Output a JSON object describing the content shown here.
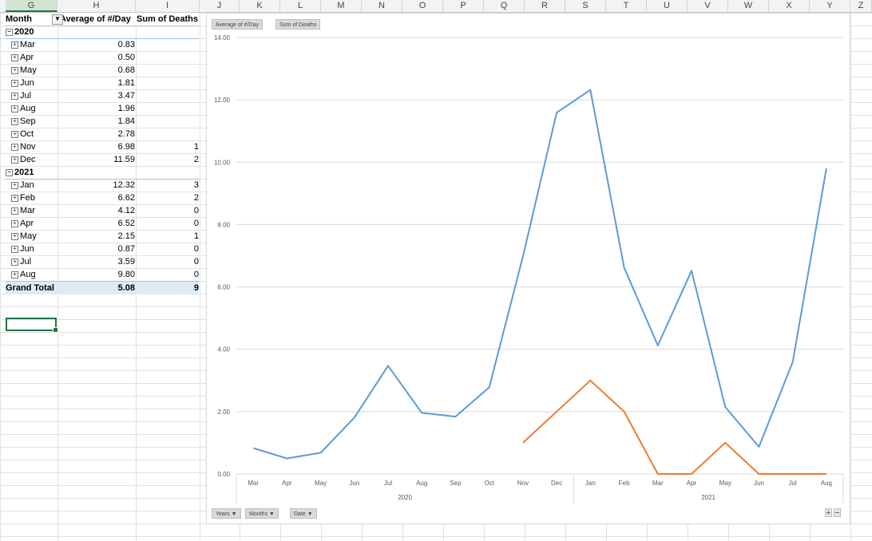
{
  "columns": [
    "G",
    "H",
    "I",
    "J",
    "K",
    "L",
    "M",
    "N",
    "O",
    "P",
    "Q",
    "R",
    "S",
    "T",
    "U",
    "V",
    "W",
    "X",
    "Y",
    "Z"
  ],
  "selected_column": "G",
  "pivot": {
    "headers": [
      "Month",
      "Average of #/Day",
      "Sum of Deaths"
    ],
    "groups": [
      {
        "year": "2020",
        "rows": [
          {
            "month": "Mar",
            "avg": "0.83",
            "deaths": ""
          },
          {
            "month": "Apr",
            "avg": "0.50",
            "deaths": ""
          },
          {
            "month": "May",
            "avg": "0.68",
            "deaths": ""
          },
          {
            "month": "Jun",
            "avg": "1.81",
            "deaths": ""
          },
          {
            "month": "Jul",
            "avg": "3.47",
            "deaths": ""
          },
          {
            "month": "Aug",
            "avg": "1.96",
            "deaths": ""
          },
          {
            "month": "Sep",
            "avg": "1.84",
            "deaths": ""
          },
          {
            "month": "Oct",
            "avg": "2.78",
            "deaths": ""
          },
          {
            "month": "Nov",
            "avg": "6.98",
            "deaths": "1"
          },
          {
            "month": "Dec",
            "avg": "11.59",
            "deaths": "2"
          }
        ]
      },
      {
        "year": "2021",
        "rows": [
          {
            "month": "Jan",
            "avg": "12.32",
            "deaths": "3"
          },
          {
            "month": "Feb",
            "avg": "6.62",
            "deaths": "2"
          },
          {
            "month": "Mar",
            "avg": "4.12",
            "deaths": "0"
          },
          {
            "month": "Apr",
            "avg": "6.52",
            "deaths": "0"
          },
          {
            "month": "May",
            "avg": "2.15",
            "deaths": "1"
          },
          {
            "month": "Jun",
            "avg": "0.87",
            "deaths": "0"
          },
          {
            "month": "Jul",
            "avg": "3.59",
            "deaths": "0"
          },
          {
            "month": "Aug",
            "avg": "9.80",
            "deaths": "0"
          }
        ]
      }
    ],
    "total": {
      "label": "Grand Total",
      "avg": "5.08",
      "deaths": "9"
    }
  },
  "chart_buttons": {
    "legend": [
      "Average of #/Day",
      "Sum of Deaths"
    ],
    "axis": [
      "Years",
      "Months",
      "Date"
    ],
    "plus": "+",
    "minus": "−"
  },
  "chart_data": {
    "type": "line",
    "categories": [
      "Mar",
      "Apr",
      "May",
      "Jun",
      "Jul",
      "Aug",
      "Sep",
      "Oct",
      "Nov",
      "Dec",
      "Jan",
      "Feb",
      "Mar",
      "Apr",
      "May",
      "Jun",
      "Jul",
      "Aug"
    ],
    "category_groups": [
      {
        "label": "2020",
        "count": 10
      },
      {
        "label": "2021",
        "count": 8
      }
    ],
    "ylim": [
      0,
      14
    ],
    "yticks": [
      "0.00",
      "2.00",
      "4.00",
      "6.00",
      "8.00",
      "10.00",
      "12.00",
      "14.00"
    ],
    "series": [
      {
        "name": "Average of #/Day",
        "color": "#5b9bd5",
        "values": [
          0.83,
          0.5,
          0.68,
          1.81,
          3.47,
          1.96,
          1.84,
          2.78,
          6.98,
          11.59,
          12.32,
          6.62,
          4.12,
          6.52,
          2.15,
          0.87,
          3.59,
          9.8
        ]
      },
      {
        "name": "Sum of Deaths",
        "color": "#ed7d31",
        "values": [
          null,
          null,
          null,
          null,
          null,
          null,
          null,
          null,
          1,
          2,
          3,
          2,
          0,
          0,
          1,
          0,
          0,
          0
        ]
      }
    ],
    "grid": true,
    "legend": "none"
  }
}
